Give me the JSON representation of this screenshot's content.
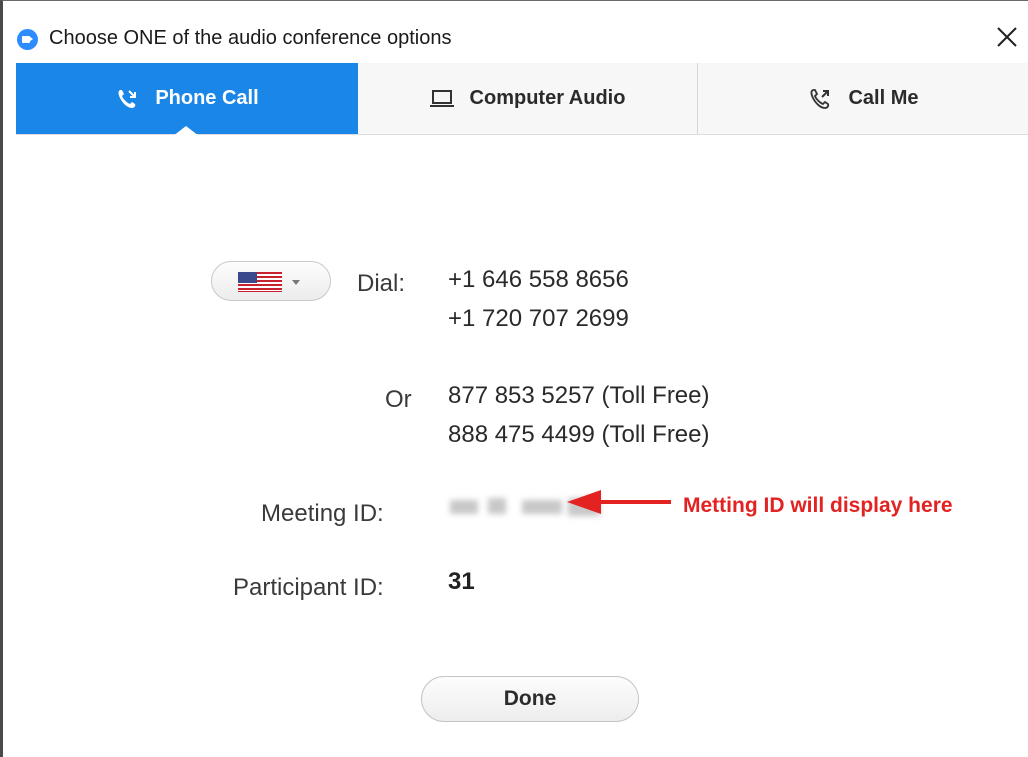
{
  "window": {
    "title": "Choose ONE of the audio conference options",
    "close_symbol": "✕"
  },
  "tabs": [
    {
      "label": "Phone Call",
      "icon": "phone-icon",
      "active": true
    },
    {
      "label": "Computer Audio",
      "icon": "laptop-icon",
      "active": false
    },
    {
      "label": "Call Me",
      "icon": "phone-icon",
      "active": false
    }
  ],
  "dial": {
    "country_icon": "us-flag-icon",
    "label": "Dial:",
    "numbers": [
      "+1 646 558 8656",
      "+1 720 707 2699"
    ]
  },
  "or": {
    "label": "Or",
    "numbers": [
      "877 853 5257 (Toll Free)",
      "888 475 4499 (Toll Free)"
    ]
  },
  "meeting_id": {
    "label": "Meeting ID:",
    "annotation": "Metting ID will display here"
  },
  "participant_id": {
    "label": "Participant ID:",
    "value": "31"
  },
  "done_button": {
    "label": "Done"
  },
  "colors": {
    "accent": "#1a86e8",
    "annotation": "#e32222"
  }
}
